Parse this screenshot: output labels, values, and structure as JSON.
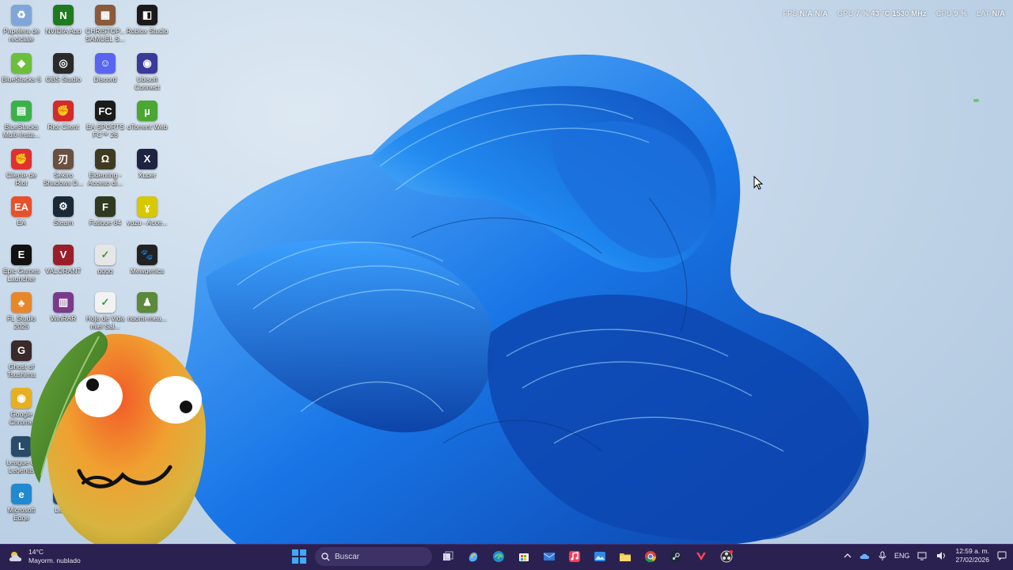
{
  "overlay": {
    "fps_label": "FPS",
    "fps_val1": "N/A",
    "fps_val2": "N/A",
    "gpu_label": "GPU",
    "gpu_val": "7 %  43 °C  1530 MHz",
    "cpu_label": "CPU",
    "cpu_val": "9 %",
    "lat_label": "LAT",
    "lat_val": "N/A"
  },
  "desktop": {
    "icons": [
      {
        "label": "Papelera de reciclaje",
        "icon": "recycle-bin-icon",
        "color": "#7fa6d8",
        "glyph": "♻"
      },
      {
        "label": "NVIDIA App",
        "icon": "nvidia-icon",
        "color": "#1f7a1f",
        "glyph": "N"
      },
      {
        "label": "CHRISTOP... SAMUEL S...",
        "icon": "folder-icon",
        "color": "#8a5a3a",
        "glyph": "▦"
      },
      {
        "label": "Roblox Studio",
        "icon": "roblox-icon",
        "color": "#1a1a1a",
        "glyph": "◧"
      },
      {
        "label": "BlueStacks 5",
        "icon": "bluestacks-icon",
        "color": "#6cbf3a",
        "glyph": "◆"
      },
      {
        "label": "OBS Studio",
        "icon": "obs-icon",
        "color": "#2a2a2a",
        "glyph": "◎"
      },
      {
        "label": "Discord",
        "icon": "discord-icon",
        "color": "#5865f2",
        "glyph": "☺"
      },
      {
        "label": "Ubisoft Connect",
        "icon": "ubisoft-icon",
        "color": "#3a3a9a",
        "glyph": "◉"
      },
      {
        "label": "BlueStacks Multi-Insta...",
        "icon": "bluestacks-multi-icon",
        "color": "#3bb14a",
        "glyph": "▤"
      },
      {
        "label": "Riot Client",
        "icon": "riot-icon",
        "color": "#d42a2a",
        "glyph": "✊"
      },
      {
        "label": "EA SPORTS FC™ 26",
        "icon": "ea-fc-icon",
        "color": "#1b1b1b",
        "glyph": "FC"
      },
      {
        "label": "uTorrent Web",
        "icon": "utorrent-icon",
        "color": "#4aa832",
        "glyph": "µ"
      },
      {
        "label": "Cliente de Riot",
        "icon": "riot-client-icon",
        "color": "#e03030",
        "glyph": "✊"
      },
      {
        "label": "Sekiro Shadows D...",
        "icon": "sekiro-icon",
        "color": "#6a5040",
        "glyph": "刃"
      },
      {
        "label": "Eldenring - Acceso di...",
        "icon": "eldenring-icon",
        "color": "#403a20",
        "glyph": "Ω"
      },
      {
        "label": "Xuper",
        "icon": "xuper-icon",
        "color": "#1d2340",
        "glyph": "X"
      },
      {
        "label": "EA",
        "icon": "ea-icon",
        "color": "#e8502a",
        "glyph": "EA"
      },
      {
        "label": "Steam",
        "icon": "steam-icon",
        "color": "#1b2838",
        "glyph": "⚙"
      },
      {
        "label": "Fatigue 84",
        "icon": "fatigue-icon",
        "color": "#2e3a20",
        "glyph": "F"
      },
      {
        "label": "yuzu - Acce...",
        "icon": "yuzu-icon",
        "color": "#d8c800",
        "glyph": "ɣ"
      },
      {
        "label": "Epic Games Launcher",
        "icon": "epic-games-icon",
        "color": "#111111",
        "glyph": "E"
      },
      {
        "label": "VALORANT",
        "icon": "valorant-icon",
        "color": "#9a1e2a",
        "glyph": "V"
      },
      {
        "label": "gggg",
        "icon": "gggg-icon",
        "color": "#e6e6e6",
        "glyph": "✓"
      },
      {
        "label": "Mewgenics",
        "icon": "mewgenics-icon",
        "color": "#222222",
        "glyph": "🐾"
      },
      {
        "label": "FL Studio 2025",
        "icon": "fl-studio-icon",
        "color": "#e8872a",
        "glyph": "♣"
      },
      {
        "label": "WinRAR",
        "icon": "winrar-icon",
        "color": "#7a3a8a",
        "glyph": "▥"
      },
      {
        "label": "Hoja de Vida miel Sal...",
        "icon": "document-icon",
        "color": "#f2f2f2",
        "glyph": "✓"
      },
      {
        "label": "naomi-mea...",
        "icon": "naomi-icon",
        "color": "#5a8a3a",
        "glyph": "♟"
      },
      {
        "label": "Ghost of Tsushima",
        "icon": "ghost-tsushima-icon",
        "color": "#3a2a2a",
        "glyph": "G"
      },
      {
        "label": "Google Chrome",
        "icon": "chrome-icon",
        "color": "#e8b020",
        "glyph": "◉"
      },
      {
        "label": "League of Legends",
        "icon": "league-icon",
        "color": "#2a4a6a",
        "glyph": "L"
      },
      {
        "label": "Microsoft Edge",
        "icon": "edge-icon",
        "color": "#1f8ad0",
        "glyph": "e"
      },
      {
        "label": "Leg...",
        "icon": "legends-icon",
        "color": "#2a4a6a",
        "glyph": "L"
      }
    ]
  },
  "taskbar": {
    "weather_temp": "14°C",
    "weather_desc": "Mayorm. nublado",
    "search_placeholder": "Buscar",
    "lang": "ENG",
    "time": "12:59 a. m.",
    "date": "27/02/2026",
    "accent": "#2b2150"
  }
}
